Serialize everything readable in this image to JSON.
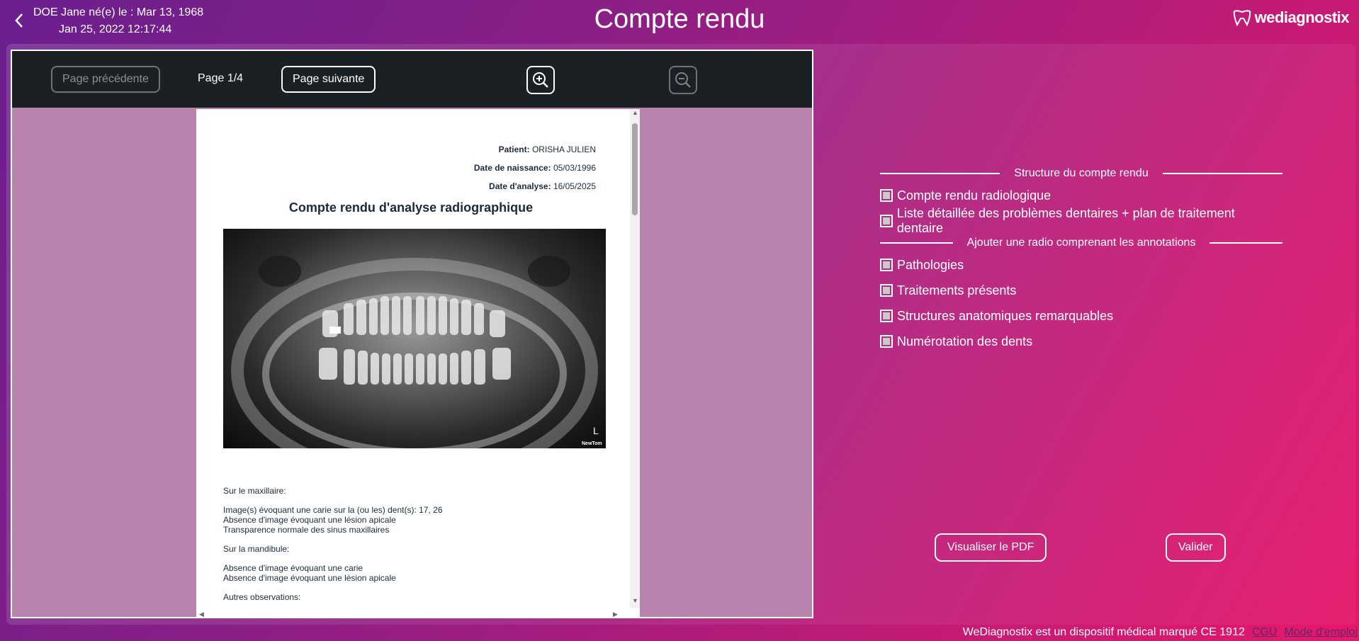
{
  "header": {
    "patient_line": "DOE Jane né(e) le : Mar 13, 1968",
    "datetime": "Jan 25, 2022 12:17:44",
    "title": "Compte rendu",
    "logo_text": "wediagnostix"
  },
  "toolbar": {
    "prev_label": "Page précédente",
    "page_indicator": "Page 1/4",
    "next_label": "Page suivante",
    "zoom_in_icon": "zoom-in-icon",
    "zoom_out_icon": "zoom-out-icon"
  },
  "document": {
    "patient_label": "Patient:",
    "patient_value": "ORISHA JULIEN",
    "birth_label": "Date de naissance:",
    "birth_value": "05/03/1996",
    "analysis_label": "Date d'analyse:",
    "analysis_value": "16/05/2025",
    "title": "Compte rendu d'analyse radiographique",
    "xray_marker": "L",
    "xray_brand": "NewTom",
    "lines": {
      "maxillaire_heading": "Sur le maxillaire:",
      "maxillaire_1": "Image(s) évoquant une carie sur la (ou les) dent(s): 17, 26",
      "maxillaire_2": "Absence d'image évoquant une lésion apicale",
      "maxillaire_3": "Transparence normale des sinus maxillaires",
      "mandibule_heading": "Sur la mandibule:",
      "mandibule_1": "Absence d'image évoquant une carie",
      "mandibule_2": "Absence d'image évoquant une lésion apicale",
      "autres_heading": "Autres observations:"
    }
  },
  "options": {
    "section1_title": "Structure du compte rendu",
    "section1_items": [
      "Compte rendu radiologique",
      "Liste détaillée des problèmes dentaires + plan de traitement dentaire"
    ],
    "section2_title": "Ajouter une radio comprenant les annotations",
    "section2_items": [
      "Pathologies",
      "Traitements présents",
      "Structures anatomiques remarquables",
      "Numérotation des dents"
    ]
  },
  "actions": {
    "preview_label": "Visualiser le PDF",
    "validate_label": "Valider"
  },
  "footer": {
    "notice": "WeDiagnostix est un dispositif médical marqué CE 1912",
    "cgu": "CGU",
    "manual": "Mode d'emploi"
  },
  "colors": {
    "gradient_start": "#6a1f8e",
    "gradient_end": "#e8176a",
    "toolbar_bg": "#1b2025",
    "viewer_bg": "#b884ae"
  }
}
